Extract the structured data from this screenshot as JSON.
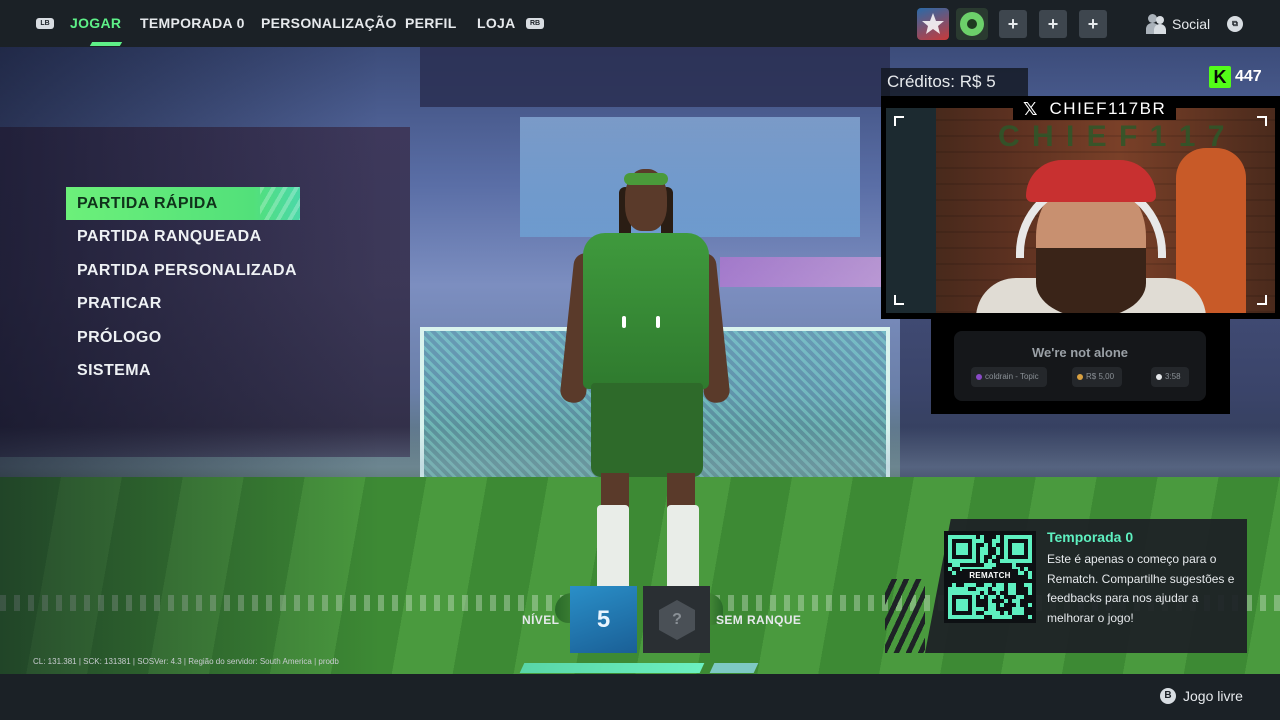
{
  "topbar": {
    "lb": "LB",
    "rb": "RB",
    "tabs": [
      {
        "label": "JOGAR",
        "active": true
      },
      {
        "label": "TEMPORADA 0",
        "active": false
      },
      {
        "label": "PERSONALIZAÇÃO",
        "active": false
      },
      {
        "label": "PERFIL",
        "active": false
      },
      {
        "label": "LOJA",
        "active": false
      }
    ],
    "plus": "+",
    "social_label": "Social"
  },
  "menu": {
    "items": [
      {
        "label": "PARTIDA RÁPIDA",
        "active": true
      },
      {
        "label": "PARTIDA RANQUEADA",
        "active": false
      },
      {
        "label": "PARTIDA PERSONALIZADA",
        "active": false
      },
      {
        "label": "PRATICAR",
        "active": false
      },
      {
        "label": "PRÓLOGO",
        "active": false
      },
      {
        "label": "SISTEMA",
        "active": false
      }
    ]
  },
  "profile": {
    "level_label": "NÍVEL",
    "level": "5",
    "rank_symbol": "?",
    "rank_label": "SEM RANQUE"
  },
  "stream": {
    "credits": "Créditos: R$ 5",
    "kick_count": "447",
    "channel": "CHIEF117BR",
    "x_symbol": "𝕏",
    "song_title": "We're not alone",
    "song_artist": "coldrain - Topic",
    "song_price": "R$ 5,00",
    "song_time": "3:58"
  },
  "season": {
    "title": "Temporada 0",
    "text": "Este é apenas o começo para o Rematch. Compartilhe sugestões e feedbacks para nos ajudar a melhorar o jogo!",
    "qr_label": "REMATCH"
  },
  "debug": "CL: 131.381 | SCK: 131381 | SOSVer: 4.3 | Região do servidor: South America | prodb",
  "bottom": {
    "b_button": "B",
    "free_play": "Jogo livre"
  },
  "colors": {
    "accent": "#5ef088",
    "season_accent": "#5ef0c0",
    "level": "#2a8fc8",
    "kick": "#53fc18"
  }
}
